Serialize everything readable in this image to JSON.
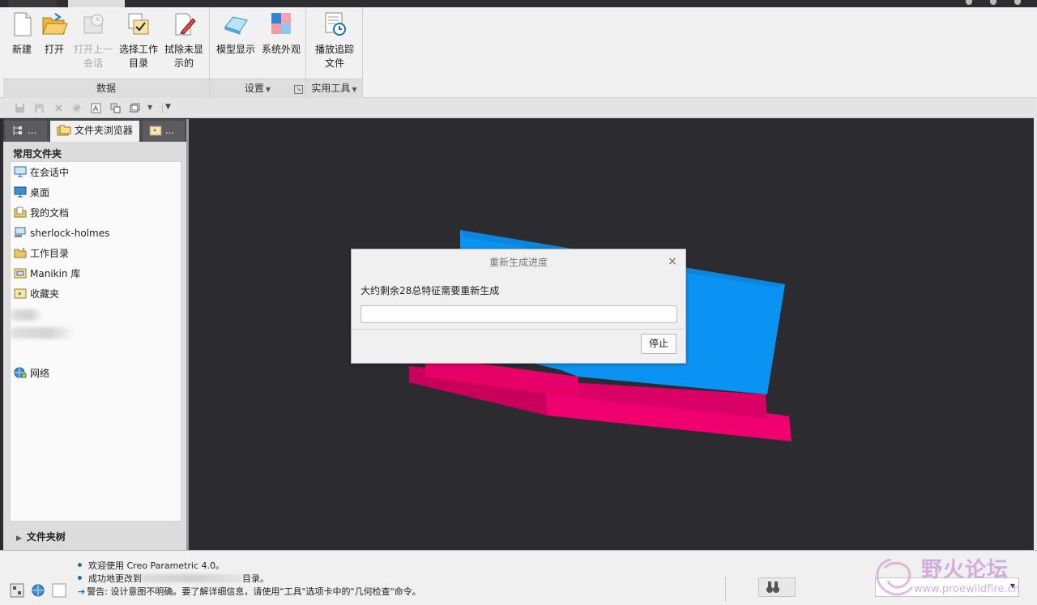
{
  "ribbon": {
    "groups": {
      "data": "数据",
      "settings": "设置",
      "utilities": "实用工具"
    },
    "buttons": {
      "new": "新建",
      "open": "打开",
      "open_last_l1": "打开上一",
      "open_last_l2": "会话",
      "select_wd_l1": "选择工作",
      "select_wd_l2": "目录",
      "erase_l1": "拭除未显",
      "erase_l2": "示的",
      "model_display": "模型显示",
      "system_appearance": "系统外观",
      "playback_l1": "播放追踪",
      "playback_l2": "文件"
    }
  },
  "panel": {
    "tabs": {
      "model_tree": "...",
      "folder_browser": "文件夹浏览器",
      "favorites": "..."
    },
    "favorites_title": "常用文件夹",
    "items": {
      "in_session": "在会话中",
      "desktop": "桌面",
      "my_documents": "我的文档",
      "user": "sherlock-holmes",
      "working_dir": "工作目录",
      "manikin": "Manikin 库",
      "favorites": "收藏夹",
      "network": "网络"
    },
    "folder_tree": "文件夹树"
  },
  "dialog": {
    "title": "重新生成进度",
    "message": "大约剩余28总特征需要重新生成",
    "progress": 0,
    "stop": "停止",
    "close": "×"
  },
  "status": {
    "msg1": "欢迎使用 Creo Parametric 4.0。",
    "msg2_a": "成功地更改到",
    "msg2_b": "目录。",
    "msg3": "警告: 设计意图不明确。要了解详细信息，请使用\"工具\"选项卡中的\"几何检查\"命令。"
  },
  "watermark": {
    "text": "野火论坛",
    "url": "www.proewildfire.cn"
  },
  "colors": {
    "model_blue": "#0a93f2",
    "model_pink": "#f0006f",
    "graphics_bg": "#2b2b30"
  }
}
